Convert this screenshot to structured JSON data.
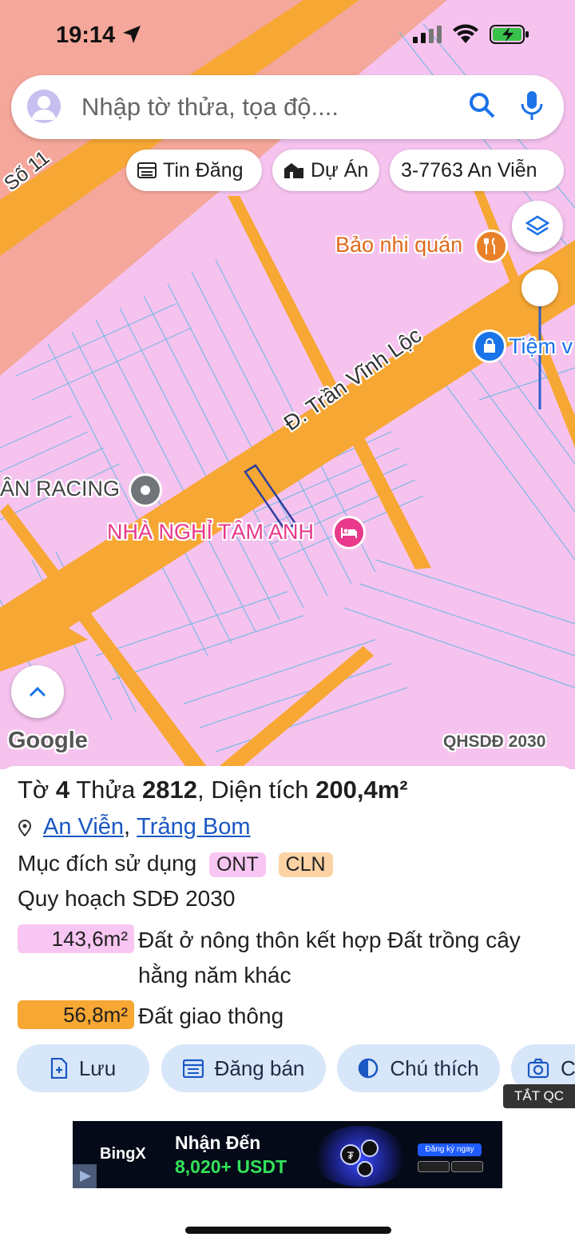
{
  "status_bar": {
    "time": "19:14"
  },
  "search": {
    "placeholder": "Nhập tờ thửa, tọa độ...."
  },
  "chips": [
    {
      "label": "Tin Đăng",
      "icon": "listing-icon"
    },
    {
      "label": "Dự Án",
      "icon": "project-icon"
    },
    {
      "label": "3-7763 An Viễn",
      "icon": ""
    }
  ],
  "map": {
    "road_number_label": "Số 11",
    "street_label": "Đ. Trần Vĩnh Lộc",
    "places": [
      {
        "name": "Bảo nhi quán",
        "icon": "restaurant-icon",
        "color": "#e06a1a"
      },
      {
        "name": "Tiệm v",
        "icon": "shopping-icon",
        "color": "#1a73e8"
      },
      {
        "name": "ÂN RACING",
        "icon": "pin-icon",
        "color": "#5f6368"
      },
      {
        "name": "NHÀ NGHỈ TÂM ANH",
        "icon": "bed-icon",
        "color": "#e8398b"
      }
    ],
    "attribution": "Google",
    "plan_label": "QHSDĐ 2030",
    "colors": {
      "residential": "#f6c3ef",
      "road": "#f7a733",
      "commercial": "#f4a79a",
      "parcel_lines": "#6fb8e0"
    }
  },
  "parcel": {
    "sheet_label": "Tờ",
    "sheet": "4",
    "plot_label": "Thửa",
    "plot": "2812",
    "area_label": ", Diện tích",
    "area": "200,4m²",
    "ward": "An Viễn",
    "separator": ",",
    "district": "Trảng Bom",
    "purpose_label": "Mục đích sử dụng",
    "purpose_codes": [
      "ONT",
      "CLN"
    ],
    "plan_title": "Quy hoạch SDĐ 2030",
    "breakdown": [
      {
        "area": "143,6m²",
        "description": "Đất ở nông thôn kết hợp Đất trồng cây hằng năm khác",
        "color": "#f8c6f2"
      },
      {
        "area": "56,8m²",
        "description": "Đất giao thông",
        "color": "#f7a733"
      }
    ]
  },
  "actions": [
    {
      "label": "Lưu",
      "icon": "add-document-icon"
    },
    {
      "label": "Đăng bán",
      "icon": "calendar-icon"
    },
    {
      "label": "Chú thích",
      "icon": "contrast-icon"
    },
    {
      "label": "C",
      "icon": "camera-icon"
    }
  ],
  "ad": {
    "hide_label": "TẮT QC",
    "brand": "BingX",
    "headline": "Nhận Đến",
    "amount": "8,020+ USDT",
    "cta": "Đăng ký ngay"
  }
}
